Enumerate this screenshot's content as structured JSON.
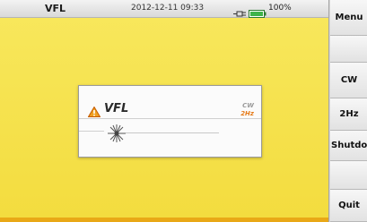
{
  "status_bar": {
    "title": "VFL",
    "datetime": "2012-12-11 09:33",
    "battery": "100%",
    "icons": [
      "plug-icon",
      "battery-icon"
    ]
  },
  "dialog": {
    "title": "VFL",
    "mode": "CW",
    "frequency": "2Hz",
    "icons": [
      "warning-icon",
      "laser-icon"
    ]
  },
  "sidebar": {
    "buttons": [
      {
        "label": "Menu"
      },
      {
        "label": ""
      },
      {
        "label": "CW"
      },
      {
        "label": "2Hz"
      },
      {
        "label": "Shutdown"
      },
      {
        "label": ""
      },
      {
        "label": "Quit"
      }
    ]
  },
  "colors": {
    "background": "#f5e04a",
    "accent_orange": "#e57a18",
    "battery_green": "#3fb34a"
  }
}
